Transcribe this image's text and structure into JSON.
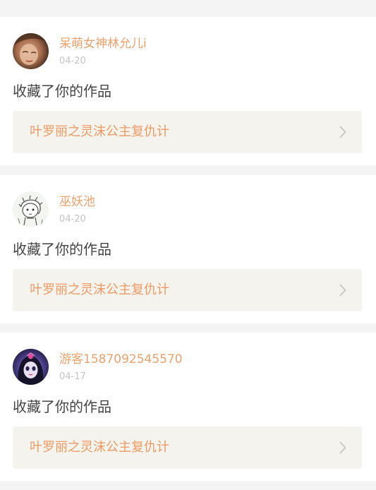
{
  "feed": {
    "items": [
      {
        "user": "呆萌女神林允儿i",
        "date": "04-20",
        "action": "收藏了你的作品",
        "work_title": "叶罗丽之灵沫公主复仇计",
        "avatar_icon": "photo-avatar"
      },
      {
        "user": "巫妖池",
        "date": "04-20",
        "action": "收藏了你的作品",
        "work_title": "叶罗丽之灵沫公主复仇计",
        "avatar_icon": "sketch-avatar"
      },
      {
        "user": "游客1587092545570",
        "date": "04-17",
        "action": "收藏了你的作品",
        "work_title": "叶罗丽之灵沫公主复仇计",
        "avatar_icon": "doll-avatar"
      }
    ]
  },
  "colors": {
    "username": "#f0a06a",
    "work_title": "#ee9a62",
    "date": "#c4c4c4",
    "action": "#444444",
    "link_bg": "#f4f3ed",
    "page_bg": "#f4f4f4"
  }
}
